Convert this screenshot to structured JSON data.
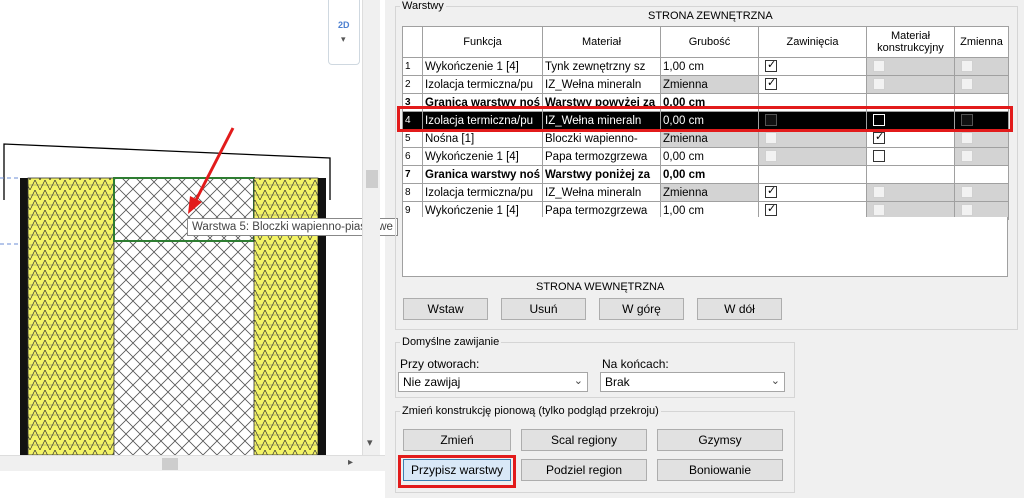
{
  "view": {
    "viewcube_label": "2D",
    "tooltip": "Warstwa 5: Bloczki wapienno-piaskowe",
    "colors": {
      "insulation": "#f4f466",
      "hatch_outline": "#2e7d32",
      "highlight": "#e21b1b",
      "arrow": "#e21b1b"
    }
  },
  "layers_group": {
    "legend": "Warstwy",
    "exterior_label": "STRONA ZEWNĘTRZNA",
    "interior_label": "STRONA WEWNĘTRZNA",
    "columns": [
      "",
      "Funkcja",
      "Materiał",
      "Grubość",
      "Zawinięcia",
      "Materiał konstrukcyjny",
      "Zmienna"
    ],
    "rows": [
      {
        "num": "1",
        "funkcja": "Wykończenie 1 [4]",
        "material": "Tynk zewnętrzny sz",
        "grubosc": "1,00 cm",
        "zawiniecia": "checked",
        "konstrukcyjny": "disabled",
        "zmienna": "disabled"
      },
      {
        "num": "2",
        "funkcja": "Izolacja termiczna/pu",
        "material": "IZ_Wełna mineraln",
        "grubosc": "Zmienna",
        "zawiniecia": "checked",
        "konstrukcyjny": "disabled",
        "zmienna": "disabled"
      },
      {
        "num": "3",
        "funkcja": "Granica warstwy noś",
        "material": "Warstwy powyżej za",
        "grubosc": "0,00 cm",
        "zawiniecia": "",
        "konstrukcyjny": "",
        "zmienna": "",
        "bold": true
      },
      {
        "num": "4",
        "funkcja": "Izolacja termiczna/pu",
        "material": "IZ_Wełna mineraln",
        "grubosc": "0,00 cm",
        "zawiniecia": "dark",
        "konstrukcyjny": "white",
        "zmienna": "dark",
        "selected": true
      },
      {
        "num": "5",
        "funkcja": "Nośna [1]",
        "material": "Bloczki wapienno-",
        "grubosc": "Zmienna",
        "zawiniecia": "disabled",
        "konstrukcyjny": "checked",
        "zmienna": "disabled"
      },
      {
        "num": "6",
        "funkcja": "Wykończenie 1 [4]",
        "material": "Papa termozgrzewa",
        "grubosc": "0,00 cm",
        "zawiniecia": "disabled",
        "konstrukcyjny": "unchecked",
        "zmienna": "disabled"
      },
      {
        "num": "7",
        "funkcja": "Granica warstwy noś",
        "material": "Warstwy poniżej za",
        "grubosc": "0,00 cm",
        "zawiniecia": "",
        "konstrukcyjny": "",
        "zmienna": "",
        "bold": true
      },
      {
        "num": "8",
        "funkcja": "Izolacja termiczna/pu",
        "material": "IZ_Wełna mineraln",
        "grubosc": "Zmienna",
        "zawiniecia": "checked",
        "konstrukcyjny": "disabled",
        "zmienna": "disabled"
      },
      {
        "num": "9",
        "funkcja": "Wykończenie 1 [4]",
        "material": "Papa termozgrzewa",
        "grubosc": "1,00 cm",
        "zawiniecia": "checked",
        "konstrukcyjny": "disabled",
        "zmienna": "disabled"
      }
    ],
    "buttons": {
      "insert": "Wstaw",
      "delete": "Usuń",
      "up": "W górę",
      "down": "W dół"
    }
  },
  "wrap_group": {
    "legend": "Domyślne zawijanie",
    "at_openings_label": "Przy otworach:",
    "at_openings_value": "Nie zawijaj",
    "at_ends_label": "Na końcach:",
    "at_ends_value": "Brak"
  },
  "vertical_group": {
    "legend": "Zmień konstrukcję pionową (tylko podgląd przekroju)",
    "buttons": {
      "modify": "Zmień",
      "merge": "Scal regiony",
      "sweeps": "Gzymsy",
      "assign": "Przypisz warstwy",
      "split": "Podziel region",
      "reveals": "Boniowanie"
    }
  }
}
